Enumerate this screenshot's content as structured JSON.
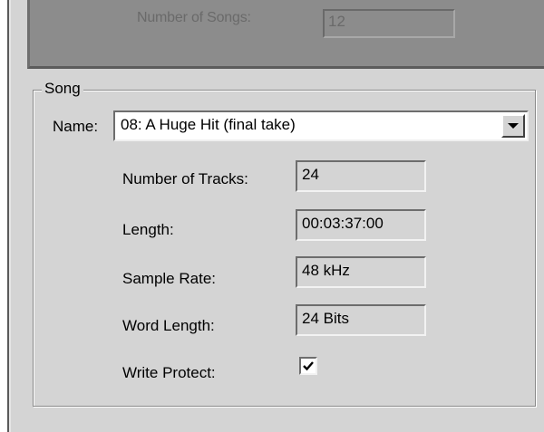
{
  "top_panel": {
    "label": "Number of Songs:",
    "value": "12"
  },
  "song_group": {
    "title": "Song",
    "name_label": "Name:",
    "name_value": "08: A Huge Hit (final take)",
    "fields": [
      {
        "label": "Number of Tracks:",
        "value": "24"
      },
      {
        "label": "Length:",
        "value": "00:03:37:00"
      },
      {
        "label": "Sample Rate:",
        "value": "48 kHz"
      },
      {
        "label": "Word Length:",
        "value": "24 Bits"
      }
    ],
    "write_protect_label": "Write Protect:",
    "write_protect_checked": true
  },
  "icons": {
    "dropdown": "chevron-down-icon",
    "check": "checkmark-icon"
  }
}
